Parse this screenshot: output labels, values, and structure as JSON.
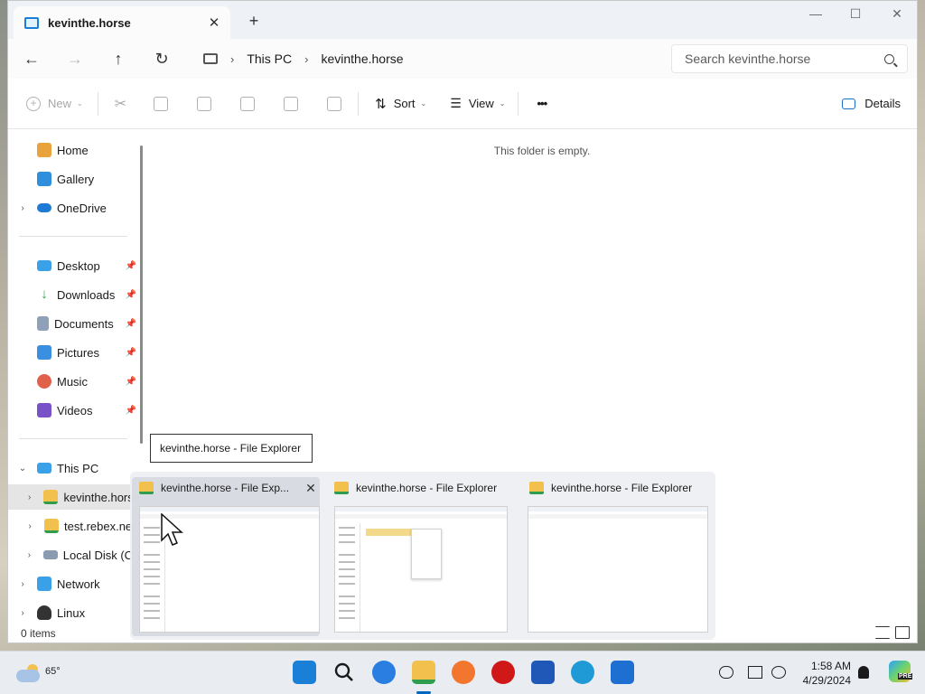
{
  "window": {
    "tab_title": "kevinthe.horse",
    "tab_close": "✕",
    "new_tab": "+",
    "minimize": "—",
    "maximize": "☐",
    "close": "✕"
  },
  "address": {
    "crumbs": [
      "This PC",
      "kevinthe.horse"
    ],
    "search_placeholder": "Search kevinthe.horse"
  },
  "toolbar": {
    "new_label": "New",
    "sort_label": "Sort",
    "view_label": "View",
    "more_label": "•••",
    "details_label": "Details"
  },
  "sidebar": {
    "items": [
      {
        "label": "Home",
        "icon": "home-icon",
        "color": "#e8a33d"
      },
      {
        "label": "Gallery",
        "icon": "gallery-icon",
        "color": "#2f8fdc"
      },
      {
        "label": "OneDrive",
        "icon": "onedrive-icon",
        "color": "#1f7ad6"
      },
      {
        "label": "Desktop",
        "icon": "desktop-icon",
        "color": "#3aa0e8"
      },
      {
        "label": "Downloads",
        "icon": "downloads-icon",
        "color": "#2e9e4e"
      },
      {
        "label": "Documents",
        "icon": "documents-icon",
        "color": "#8ea1b8"
      },
      {
        "label": "Pictures",
        "icon": "pictures-icon",
        "color": "#3b8fe0"
      },
      {
        "label": "Music",
        "icon": "music-icon",
        "color": "#e0604a"
      },
      {
        "label": "Videos",
        "icon": "videos-icon",
        "color": "#7a52c8"
      },
      {
        "label": "This PC",
        "icon": "this-pc-icon",
        "color": "#3aa0e8"
      },
      {
        "label": "kevinthe.horse",
        "icon": "network-drive-icon",
        "color": "#f2c04c"
      },
      {
        "label": "test.rebex.net",
        "icon": "network-drive-icon",
        "color": "#f2c04c"
      },
      {
        "label": "Local Disk (C:)",
        "icon": "disk-icon",
        "color": "#8a9bb0"
      },
      {
        "label": "Network",
        "icon": "network-icon",
        "color": "#3aa0e8"
      },
      {
        "label": "Linux",
        "icon": "linux-icon",
        "color": "#333333"
      }
    ]
  },
  "content": {
    "empty_message": "This folder is empty."
  },
  "status": {
    "item_count": "0 items"
  },
  "tooltip": {
    "text": "kevinthe.horse - File Explorer"
  },
  "previews": [
    {
      "title": "kevinthe.horse - File Exp...",
      "close": "✕"
    },
    {
      "title": "kevinthe.horse - File Explorer"
    },
    {
      "title": "kevinthe.horse - File Explorer"
    }
  ],
  "taskbar": {
    "weather_temp": "65°",
    "time": "1:58 AM",
    "date": "4/29/2024",
    "copilot_badge": "PRE"
  },
  "colors": {
    "accent": "#0067c0",
    "folder": "#f2c04c"
  }
}
